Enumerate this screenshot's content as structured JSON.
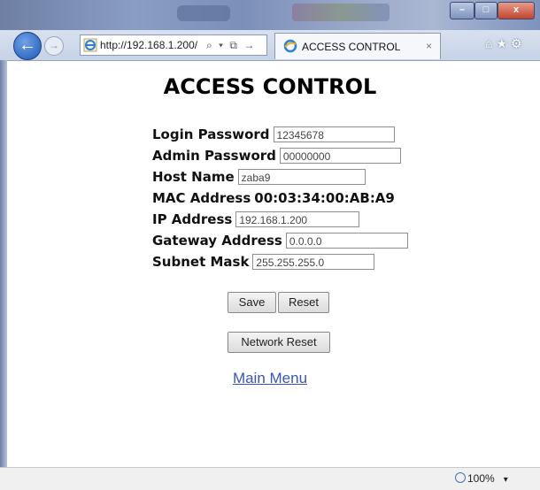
{
  "browser": {
    "address_url": "http://192.168.1.200/",
    "address_tools": "⌕ ▾ ⧉ →",
    "tab_title": "ACCESS CONTROL",
    "tab_close": "×",
    "nav_back": "←",
    "nav_forward": "→",
    "window_buttons": {
      "minimize": "–",
      "maximize": "□",
      "close": "x"
    },
    "right_icons": "⌂★⚙"
  },
  "page": {
    "title": "ACCESS CONTROL",
    "fields": {
      "login_password": {
        "label": "Login Password",
        "value": "12345678"
      },
      "admin_password": {
        "label": "Admin Password",
        "value": "00000000"
      },
      "host_name": {
        "label": "Host Name",
        "value": "zaba9"
      },
      "mac_address": {
        "label": "MAC Address",
        "value": "00:03:34:00:AB:A9"
      },
      "ip_address": {
        "label": "IP Address",
        "value": "192.168.1.200"
      },
      "gateway_address": {
        "label": "Gateway Address",
        "value": "0.0.0.0"
      },
      "subnet_mask": {
        "label": "Subnet Mask",
        "value": "255.255.255.0"
      }
    },
    "buttons": {
      "save": "Save",
      "reset": "Reset",
      "network_reset": "Network Reset"
    },
    "main_menu_link": "Main Menu"
  },
  "statusbar": {
    "zoom": "100%",
    "zoom_arrow": "▾"
  }
}
